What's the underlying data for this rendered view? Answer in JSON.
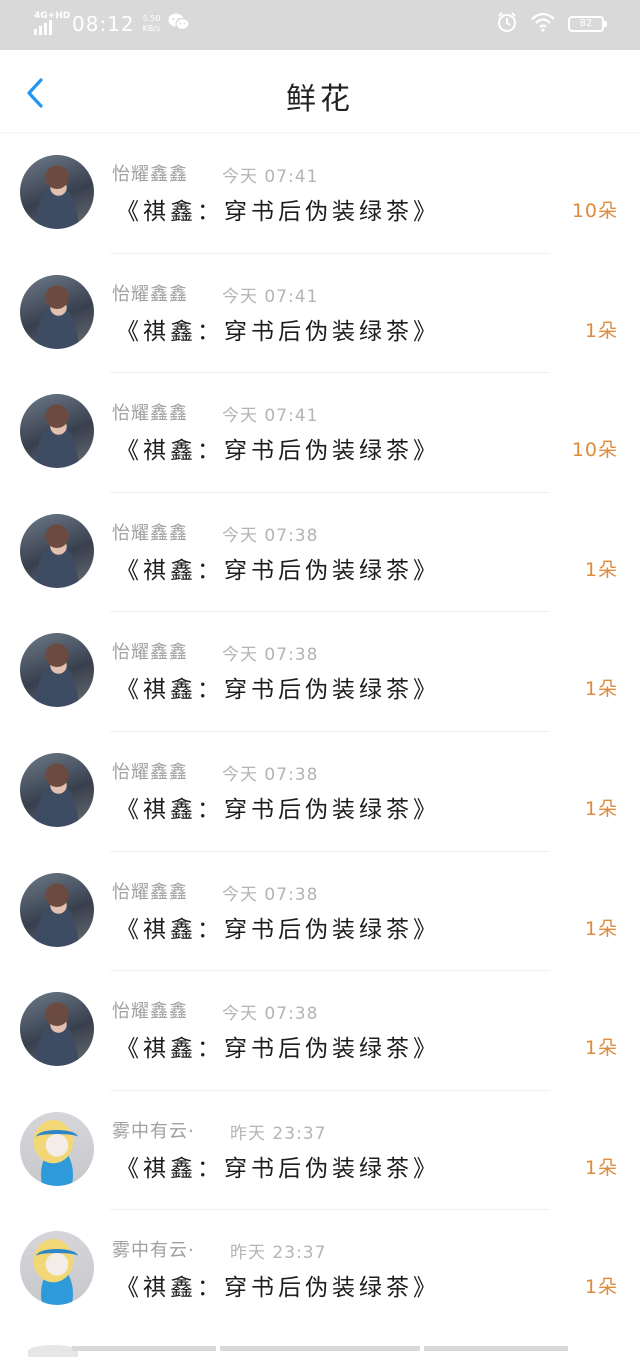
{
  "status_bar": {
    "network": "4G+HD",
    "time": "08:12",
    "speed_value": "5.50",
    "speed_unit": "KB/s",
    "battery": "82",
    "icons": [
      "wechat-icon",
      "alarm-icon",
      "wifi-icon",
      "battery-icon"
    ]
  },
  "header": {
    "title": "鲜花",
    "back_icon": "chevron-left-icon"
  },
  "colors": {
    "accent_blue": "#2196f3",
    "count_orange": "#e08a3c",
    "status_bar_bg": "#d9d9d9"
  },
  "items": [
    {
      "user": "怡耀鑫鑫",
      "time": "今天 07:41",
      "book": "《祺鑫：穿书后伪装绿茶》",
      "count": "10朵",
      "avatar": "a1"
    },
    {
      "user": "怡耀鑫鑫",
      "time": "今天 07:41",
      "book": "《祺鑫：穿书后伪装绿茶》",
      "count": "1朵",
      "avatar": "a1"
    },
    {
      "user": "怡耀鑫鑫",
      "time": "今天 07:41",
      "book": "《祺鑫：穿书后伪装绿茶》",
      "count": "10朵",
      "avatar": "a1"
    },
    {
      "user": "怡耀鑫鑫",
      "time": "今天 07:38",
      "book": "《祺鑫：穿书后伪装绿茶》",
      "count": "1朵",
      "avatar": "a1"
    },
    {
      "user": "怡耀鑫鑫",
      "time": "今天 07:38",
      "book": "《祺鑫：穿书后伪装绿茶》",
      "count": "1朵",
      "avatar": "a1"
    },
    {
      "user": "怡耀鑫鑫",
      "time": "今天 07:38",
      "book": "《祺鑫：穿书后伪装绿茶》",
      "count": "1朵",
      "avatar": "a1"
    },
    {
      "user": "怡耀鑫鑫",
      "time": "今天 07:38",
      "book": "《祺鑫：穿书后伪装绿茶》",
      "count": "1朵",
      "avatar": "a1"
    },
    {
      "user": "怡耀鑫鑫",
      "time": "今天 07:38",
      "book": "《祺鑫：穿书后伪装绿茶》",
      "count": "1朵",
      "avatar": "a1"
    },
    {
      "user": "雾中有云·",
      "time": "昨天 23:37",
      "book": "《祺鑫：穿书后伪装绿茶》",
      "count": "1朵",
      "avatar": "a2"
    },
    {
      "user": "雾中有云·",
      "time": "昨天 23:37",
      "book": "《祺鑫：穿书后伪装绿茶》",
      "count": "1朵",
      "avatar": "a2"
    }
  ]
}
